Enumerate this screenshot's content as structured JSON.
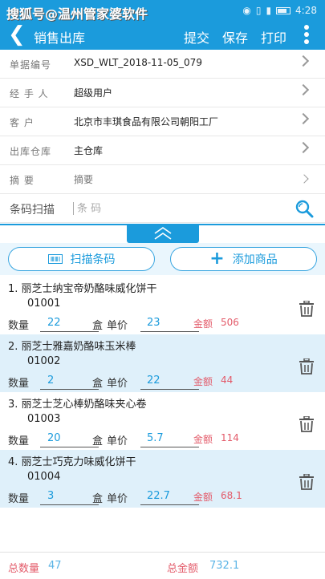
{
  "status_bar": {
    "watermark": "搜狐号@温州管家婆软件",
    "time": "4:28"
  },
  "header": {
    "title": "销售出库",
    "actions": [
      "提交",
      "保存",
      "打印"
    ]
  },
  "form": {
    "doc_no_label": "单据编号",
    "doc_no": "XSD_WLT_2018-11-05_079",
    "handler_label": "经 手 人",
    "handler": "超级用户",
    "customer_label": "客 户",
    "customer": "北京市丰琪食品有限公司朝阳工厂",
    "warehouse_label": "出库仓库",
    "warehouse": "主仓库",
    "summary_label": "摘 要",
    "summary_placeholder": "摘要",
    "barcode_label": "条码扫描",
    "barcode_placeholder": "条 码"
  },
  "buttons": {
    "scan": "扫描条码",
    "add": "添加商品"
  },
  "labels": {
    "qty": "数量",
    "unit": "盒",
    "price": "单价",
    "amount": "金额"
  },
  "items": [
    {
      "index": "1.",
      "name": "丽芝士纳宝帝奶酪味威化饼干",
      "code": "01001",
      "qty": "22",
      "price": "23",
      "amount": "506"
    },
    {
      "index": "2.",
      "name": "丽芝士雅嘉奶酪味玉米棒",
      "code": "01002",
      "qty": "2",
      "price": "22",
      "amount": "44"
    },
    {
      "index": "3.",
      "name": "丽芝士芝心棒奶酪味夹心卷",
      "code": "01003",
      "qty": "20",
      "price": "5.7",
      "amount": "114"
    },
    {
      "index": "4.",
      "name": "丽芝士巧克力味威化饼干",
      "code": "01004",
      "qty": "3",
      "price": "22.7",
      "amount": "68.1"
    }
  ],
  "footer": {
    "total_qty_label": "总数量",
    "total_qty": "47",
    "total_amount_label": "总金额",
    "total_amount": "732.1"
  },
  "colors": {
    "accent": "#1b9bdc",
    "amount": "#e35b6a",
    "row_alt": "#dff0fa"
  }
}
